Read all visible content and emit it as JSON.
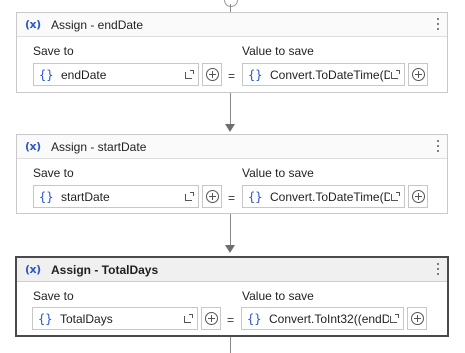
{
  "activities": [
    {
      "icon": "(x)",
      "title": "Assign - endDate",
      "save_to_label": "Save to",
      "value_label": "Value to save",
      "save_to_value": "endDate",
      "value_to_save": "Convert.ToDateTime(D",
      "equals": "=",
      "brace": "{}",
      "selected": false
    },
    {
      "icon": "(x)",
      "title": "Assign - startDate",
      "save_to_label": "Save to",
      "value_label": "Value to save",
      "save_to_value": "startDate",
      "value_to_save": "Convert.ToDateTime(D",
      "equals": "=",
      "brace": "{}",
      "selected": false
    },
    {
      "icon": "(x)",
      "title": "Assign - TotalDays",
      "save_to_label": "Save to",
      "value_label": "Value to save",
      "save_to_value": "TotalDays",
      "value_to_save": "Convert.ToInt32((endD",
      "equals": "=",
      "brace": "{}",
      "selected": true
    }
  ],
  "icons": {
    "variable": "variable-icon",
    "expand": "expand-icon",
    "add": "plus-circle-icon",
    "menu": "kebab-menu-icon"
  },
  "colors": {
    "accent": "#2b58c5",
    "selected_border": "#4a4a4a",
    "card_border": "#c9c9c9"
  }
}
